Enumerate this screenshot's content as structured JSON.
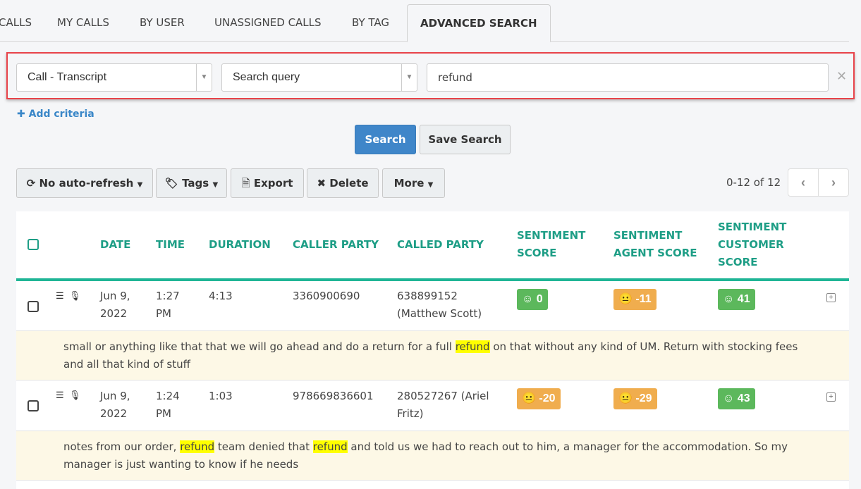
{
  "tabs": [
    {
      "label": "CALLS",
      "active": false
    },
    {
      "label": "MY CALLS",
      "active": false
    },
    {
      "label": "BY USER",
      "active": false
    },
    {
      "label": "UNASSIGNED CALLS",
      "active": false
    },
    {
      "label": "BY TAG",
      "active": false
    },
    {
      "label": "ADVANCED SEARCH",
      "active": true
    }
  ],
  "criteria": {
    "field_select": "Call - Transcript",
    "operator_select": "Search query",
    "query_value": "refund",
    "clear_icon": "close-icon",
    "add_criteria_label": "Add criteria",
    "highlight_color": "#e8434a"
  },
  "actions": {
    "search_label": "Search",
    "save_search_label": "Save Search"
  },
  "toolbar": {
    "auto_refresh_label": "No auto-refresh",
    "tags_label": "Tags",
    "export_label": "Export",
    "delete_label": "Delete",
    "more_label": "More"
  },
  "pagination": {
    "text": "0-12 of 12",
    "prev_icon": "chevron-left-icon",
    "next_icon": "chevron-right-icon"
  },
  "table": {
    "accent_color": "#1fb596",
    "headers": {
      "date": "DATE",
      "time": "TIME",
      "duration": "DURATION",
      "caller": "CALLER PARTY",
      "called": "CALLED PARTY",
      "sentiment_1": "SENTIMENT",
      "sentiment_2": "SCORE",
      "agent_1": "SENTIMENT",
      "agent_2": "AGENT SCORE",
      "customer_1": "SENTIMENT",
      "customer_2": "CUSTOMER",
      "customer_3": "SCORE"
    },
    "rows": [
      {
        "date_1": "Jun 9,",
        "date_2": "2022",
        "time_1": "1:27",
        "time_2": "PM",
        "duration": "4:13",
        "caller": "3360900690",
        "called_1": "638899152",
        "called_2": "(Matthew Scott)",
        "sentiment": "0",
        "sentiment_type": "positive",
        "agent": "-11",
        "agent_type": "neutral",
        "customer": "41",
        "customer_type": "positive",
        "snippet_parts": [
          "small or anything like that that we will go ahead and do a return for a full ",
          "refund",
          " on that without any kind of UM. Return with stocking fees and all that kind of stuff"
        ]
      },
      {
        "date_1": "Jun 9,",
        "date_2": "2022",
        "time_1": "1:24",
        "time_2": "PM",
        "duration": "1:03",
        "caller": "978669836601",
        "called_1": "280527267 (Ariel",
        "called_2": "Fritz)",
        "sentiment": "-20",
        "sentiment_type": "neutral",
        "agent": "-29",
        "agent_type": "neutral",
        "customer": "43",
        "customer_type": "positive",
        "snippet_parts": [
          "notes from our order, ",
          "refund",
          " team denied that ",
          "refund",
          " and told us we had to reach out to him, a manager for the accommodation. So my manager is just wanting to know if he needs"
        ]
      }
    ]
  }
}
